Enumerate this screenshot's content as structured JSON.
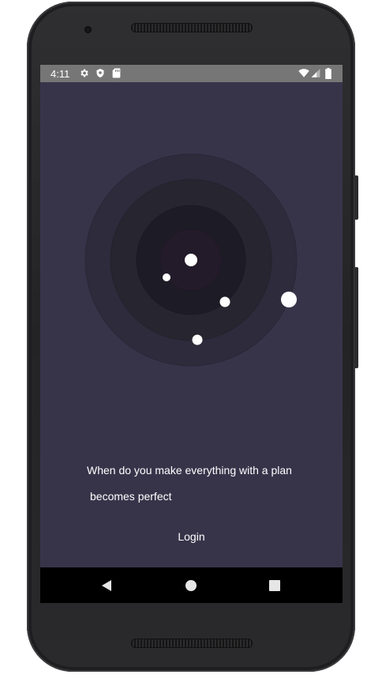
{
  "status_bar": {
    "time": "4:11",
    "icons": [
      "settings-icon",
      "shield-icon",
      "sd-card-icon",
      "wifi-icon",
      "cellular-signal-icon",
      "battery-icon"
    ]
  },
  "illustration": {
    "name": "orbit-rings-graphic",
    "ring_colors": [
      "#2d2b3c",
      "#262530",
      "#1d1c26",
      "#231a2a"
    ]
  },
  "intro": {
    "line1": "When do you make everything with a plan",
    "line2": "becomes perfect"
  },
  "login_label": "Login",
  "nav_bar": {
    "buttons": [
      "back-icon",
      "home-icon",
      "recents-icon"
    ]
  },
  "colors": {
    "screen_background": "#37344a",
    "status_bar": "#767676",
    "nav_bar": "#000000",
    "text": "#ffffff"
  }
}
